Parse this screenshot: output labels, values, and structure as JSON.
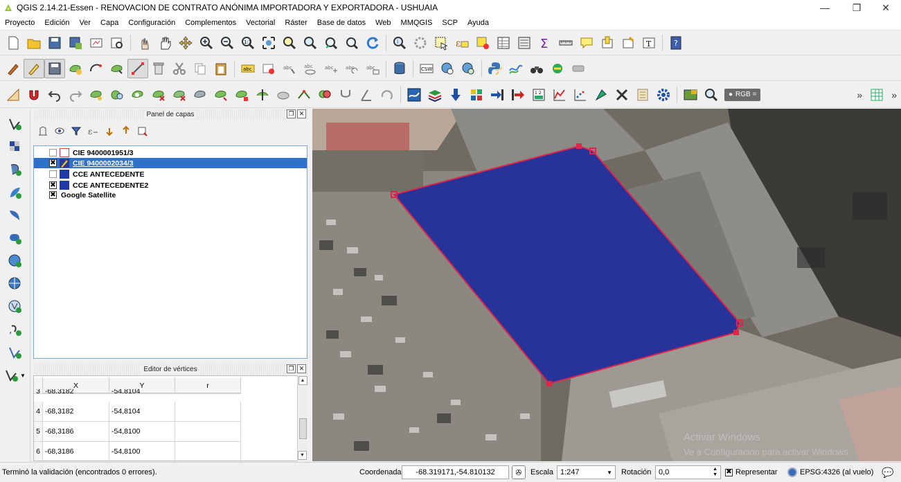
{
  "window": {
    "title": "QGIS 2.14.21-Essen - RENOVACION DE CONTRATO ANÓNIMA IMPORTADORA Y EXPORTADORA - USHUAIA",
    "minimize_glyph": "—",
    "maximize_glyph": "❐",
    "close_glyph": "✕"
  },
  "menu": [
    "Proyecto",
    "Edición",
    "Ver",
    "Capa",
    "Configuración",
    "Complementos",
    "Vectorial",
    "Ráster",
    "Base de datos",
    "Web",
    "MMQGIS",
    "SCP",
    "Ayuda"
  ],
  "toolbar3": {
    "rgb_label": "RGB =",
    "overflow_glyph": "»"
  },
  "layers_panel": {
    "title": "Panel de capas",
    "layers": [
      {
        "name": "CIE 9400001951/3",
        "checked": false,
        "swatch": "#ffffff",
        "swatch_border": "#d04040",
        "selected": false,
        "indent": 1
      },
      {
        "name": "CIE 9400002034/3",
        "checked": true,
        "swatch": "#2a3a9a",
        "swatch_border": "#2a3a9a",
        "selected": true,
        "editing": true,
        "indent": 1
      },
      {
        "name": "CCE ANTECEDENTE",
        "checked": false,
        "swatch": "#1f3aa8",
        "swatch_border": "#1f3aa8",
        "selected": false,
        "indent": 1
      },
      {
        "name": "CCE ANTECEDENTE2",
        "checked": true,
        "swatch": "#1f3aa8",
        "swatch_border": "#1f3aa8",
        "selected": false,
        "indent": 1
      },
      {
        "name": "Google Satellite",
        "checked": true,
        "swatch": null,
        "selected": false,
        "indent": 0
      }
    ]
  },
  "vertex_editor": {
    "title": "Editor de vértices",
    "columns": [
      "X",
      "Y",
      "r"
    ],
    "partial_row": {
      "num": "3",
      "x": "-68,3182",
      "y": "-54,8104"
    },
    "rows": [
      {
        "num": "4",
        "x": "-68,3182",
        "y": "-54,8104",
        "r": ""
      },
      {
        "num": "5",
        "x": "-68,3186",
        "y": "-54,8100",
        "r": ""
      },
      {
        "num": "6",
        "x": "-68,3186",
        "y": "-54,8100",
        "r": ""
      }
    ]
  },
  "map": {
    "polygon_fill": "#273399",
    "polygon_stroke": "#e0254a",
    "watermark_line1": "Activar Windows",
    "watermark_line2": "Ve a Configuración para activar Windows."
  },
  "statusbar": {
    "message": "Terminó la validación (encontrados 0 errores).",
    "coord_label": "Coordenada",
    "coord_value": "-68.319171,-54.810132",
    "scale_label": "Escala",
    "scale_value": "1:247",
    "rotation_label": "Rotación",
    "rotation_value": "0,0",
    "render_label": "Representar",
    "render_checked": true,
    "crs_label": "EPSG:4326 (al vuelo)"
  }
}
